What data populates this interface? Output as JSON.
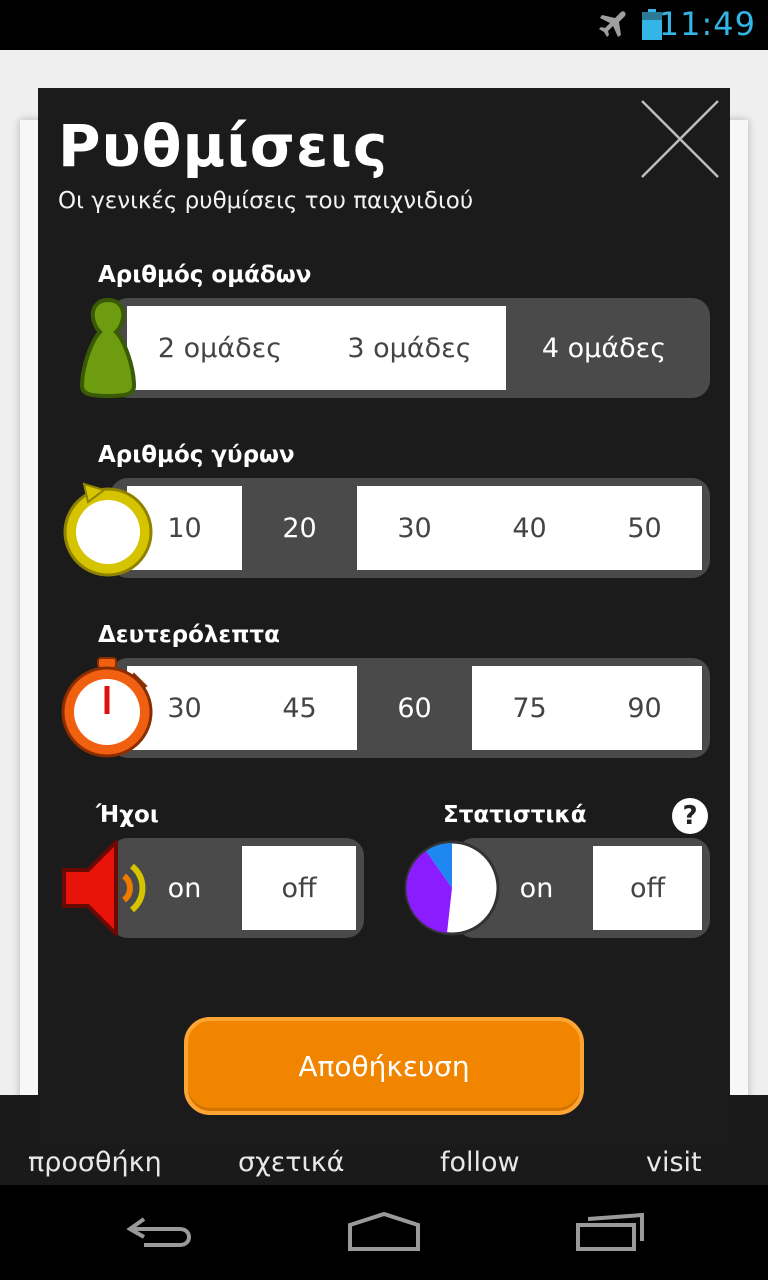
{
  "status_bar": {
    "time": "11:49",
    "icons": [
      "airplane-icon",
      "battery-icon"
    ],
    "clock_color": "#33b5e5"
  },
  "background_tabs": [
    "προσθήκη",
    "σχετικά",
    "follow",
    "visit"
  ],
  "dialog": {
    "title": "Ρυθμίσεις",
    "subtitle": "Οι γενικές ρυθμίσεις του παιχνιδιού",
    "close_icon": "close-icon"
  },
  "teams": {
    "label": "Αριθμός ομάδων",
    "icon": "pawn-icon",
    "options": [
      "2 ομάδες",
      "3 ομάδες",
      "4 ομάδες"
    ],
    "selected": "4 ομάδες"
  },
  "rounds": {
    "label": "Αριθμός γύρων",
    "icon": "rounds-icon",
    "options": [
      "10",
      "20",
      "30",
      "40",
      "50"
    ],
    "selected": "20"
  },
  "seconds": {
    "label": "Δευτερόλεπτα",
    "icon": "stopwatch-icon",
    "options": [
      "30",
      "45",
      "60",
      "75",
      "90"
    ],
    "selected": "60"
  },
  "sounds": {
    "label": "Ήχοι",
    "icon": "speaker-icon",
    "on": "on",
    "off": "off",
    "selected": "on"
  },
  "stats": {
    "label": "Στατιστικά",
    "icon": "pie-chart-icon",
    "help": "?",
    "on": "on",
    "off": "off",
    "selected": "on"
  },
  "save_label": "Αποθήκευση",
  "colors": {
    "accent_orange": "#f18500",
    "dialog_bg": "#1b1b1b",
    "track_bg": "#4a4a4a"
  }
}
